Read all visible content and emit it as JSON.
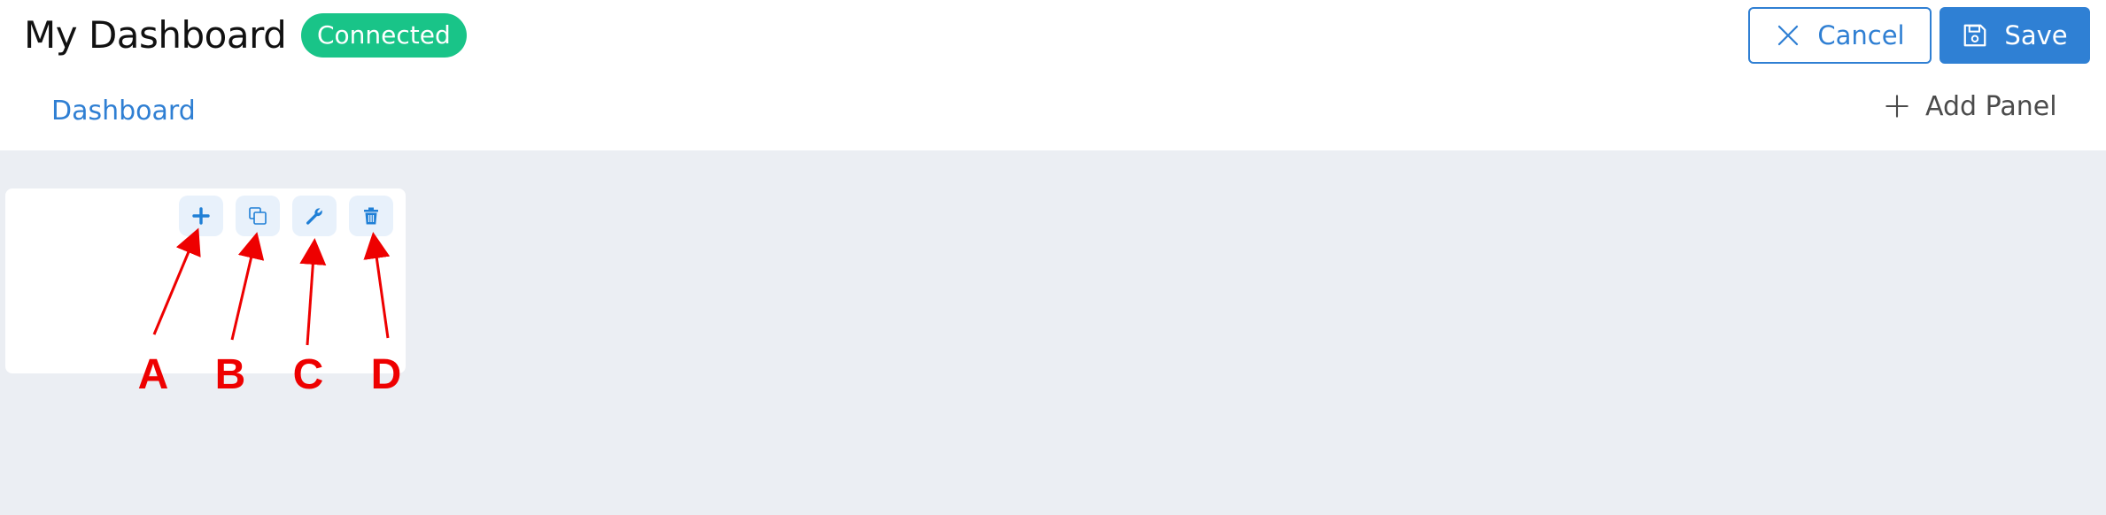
{
  "header": {
    "title": "My Dashboard",
    "status_badge": "Connected",
    "cancel_label": "Cancel",
    "save_label": "Save"
  },
  "tabs": [
    {
      "label": "Dashboard",
      "active": true
    }
  ],
  "toolbar": {
    "add_panel_label": "Add Panel"
  },
  "panel": {
    "tools": [
      {
        "icon": "plus-icon"
      },
      {
        "icon": "copy-icon"
      },
      {
        "icon": "wrench-icon"
      },
      {
        "icon": "trash-icon"
      }
    ]
  },
  "annotations": {
    "labels": [
      "A",
      "B",
      "C",
      "D"
    ],
    "color": "#ee0000"
  },
  "colors": {
    "accent": "#2f80d4",
    "status_connected": "#19c488",
    "canvas_bg": "#ebeef3"
  }
}
